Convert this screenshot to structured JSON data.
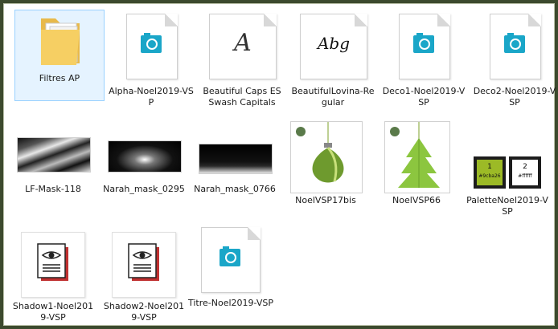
{
  "files": [
    {
      "name": "Filtres AP",
      "icon": "folder-icon",
      "selected": true
    },
    {
      "name": "Alpha-Noel2019-VSP",
      "icon": "psp-image-icon"
    },
    {
      "name": "Beautiful Caps ES Swash Capitals",
      "icon": "font-file-icon",
      "glyph": "A"
    },
    {
      "name": "BeautifulLovina-Regular",
      "icon": "font-file-icon",
      "glyph": "Abg"
    },
    {
      "name": "Deco1-Noel2019-VSP",
      "icon": "psp-image-icon"
    },
    {
      "name": "Deco2-Noel2019-VSP",
      "icon": "psp-image-icon"
    },
    {
      "name": "LF-Mask-118",
      "icon": "mask-thumbnail"
    },
    {
      "name": "Narah_mask_0295",
      "icon": "mask-thumbnail"
    },
    {
      "name": "Narah_mask_0766",
      "icon": "mask-thumbnail"
    },
    {
      "name": "NoelVSP17bis",
      "icon": "ornament-thumbnail"
    },
    {
      "name": "NoelVSP66",
      "icon": "tree-ornament-thumbnail"
    },
    {
      "name": "PaletteNoel2019-VSP",
      "icon": "palette-thumbnail",
      "swatches": [
        {
          "num": "1",
          "hex": "#9cba26"
        },
        {
          "num": "2",
          "hex": "#ffffff"
        }
      ]
    },
    {
      "name": "Shadow1-Noel2019-VSP",
      "icon": "shadow-preset-icon"
    },
    {
      "name": "Shadow2-Noel2019-VSP",
      "icon": "shadow-preset-icon"
    },
    {
      "name": "Titre-Noel2019-VSP",
      "icon": "psp-image-icon"
    }
  ],
  "palette_labels": [
    "#9cba26",
    "#ffffff"
  ],
  "colors": {
    "frame": "#3c4a2e",
    "selection": "#e5f3ff",
    "psp_accent": "#1aa6c8",
    "palette_green": "#9cba26"
  }
}
